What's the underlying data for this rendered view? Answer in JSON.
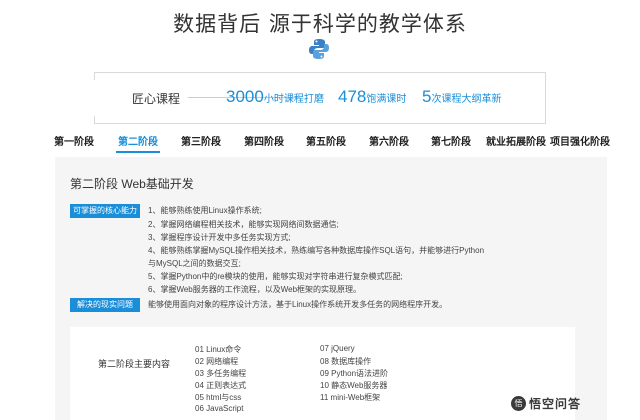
{
  "header": {
    "title": "数据背后  源于科学的教学体系",
    "logo_icon": "python-logo-icon"
  },
  "banner": {
    "label": "匠心课程",
    "stats": [
      {
        "num": "3000",
        "unit": "小时课程打磨"
      },
      {
        "num": "478",
        "unit": "饱满课时"
      },
      {
        "num": "5",
        "unit": "次课程大纲革新"
      }
    ]
  },
  "tabs": [
    {
      "label": "第一阶段"
    },
    {
      "label": "第二阶段",
      "active": true
    },
    {
      "label": "第三阶段"
    },
    {
      "label": "第四阶段"
    },
    {
      "label": "第五阶段"
    },
    {
      "label": "第六阶段"
    },
    {
      "label": "第七阶段"
    },
    {
      "label": "就业拓展阶段"
    },
    {
      "label": "项目强化阶段"
    }
  ],
  "panel": {
    "stage_title": "第二阶段  Web基础开发",
    "core_badge": "可掌握的核心能力",
    "core_items": [
      "1、能够熟练使用Linux操作系统;",
      "2、掌握网络编程相关技术，能够实现网络间数据通信;",
      "3、掌握程序设计开发中多任务实现方式;",
      "4、能够熟练掌握MySQL操作相关技术，熟练编写各种数据库操作SQL语句，并能够进行Python",
      "与MySQL之间的数据交互;",
      "5、掌握Python中的re模块的使用，能够实现对字符串进行复杂模式匹配;",
      "6、掌握Web服务器的工作流程，以及Web框架的实现原理。"
    ],
    "problem_badge": "解决的现实问题",
    "problem_text": "能够使用面向对象的程序设计方法，基于Linux操作系统开发多任务的网络程序开发。",
    "content_title": "第二阶段主要内容",
    "courses_left": [
      "01 Linux命令",
      "02 网络编程",
      "03 多任务编程",
      "04 正则表达式",
      "05 html与css",
      "06 JavaScript"
    ],
    "courses_right": [
      "07 jQuery",
      "08 数据库操作",
      "09 Python语法进阶",
      "10 静态Web服务器",
      "11 mini-Web框架"
    ]
  },
  "watermark": {
    "icon": "wukong-qa-icon",
    "glyph": "悟",
    "text": "悟空问答"
  },
  "colors": {
    "accent": "#1a8ed8",
    "panel_bg": "#f5f5f5"
  }
}
